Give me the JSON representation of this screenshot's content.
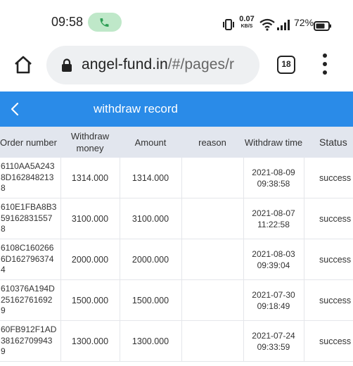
{
  "status_bar": {
    "time": "09:58",
    "net_speed_value": "0.07",
    "net_speed_unit": "KB/S",
    "battery": "72%",
    "icons": [
      "phone-icon",
      "vibrate-icon",
      "wifi-icon",
      "signal-icon",
      "battery-icon"
    ]
  },
  "browser": {
    "url_host": "angel-fund.in",
    "url_path": "/#/pages/r",
    "tab_count": "18"
  },
  "page": {
    "title": "withdraw record",
    "header_color": "#2a8be8"
  },
  "table": {
    "columns": [
      "Order number",
      "Withdraw money",
      "Amount",
      "reason",
      "Withdraw time",
      "Status"
    ],
    "rows": [
      {
        "order_lines": [
          "6110AA5A243",
          "8D162848213",
          "8"
        ],
        "money": "1314.000",
        "amount": "1314.000",
        "reason": "",
        "date": "2021-08-09",
        "time": "09:38:58",
        "status": "success"
      },
      {
        "order_lines": [
          "610E1FBA8B3",
          "59162831557",
          "8"
        ],
        "money": "3100.000",
        "amount": "3100.000",
        "reason": "",
        "date": "2021-08-07",
        "time": "11:22:58",
        "status": "success"
      },
      {
        "order_lines": [
          "6108C160266",
          "6D162796374",
          "4"
        ],
        "money": "2000.000",
        "amount": "2000.000",
        "reason": "",
        "date": "2021-08-03",
        "time": "09:39:04",
        "status": "success"
      },
      {
        "order_lines": [
          "610376A194D",
          "25162761692",
          "9"
        ],
        "money": "1500.000",
        "amount": "1500.000",
        "reason": "",
        "date": "2021-07-30",
        "time": "09:18:49",
        "status": "success"
      },
      {
        "order_lines": [
          "60FB912F1AD",
          "38162709943",
          "9"
        ],
        "money": "1300.000",
        "amount": "1300.000",
        "reason": "",
        "date": "2021-07-24",
        "time": "09:33:59",
        "status": "success"
      }
    ]
  }
}
